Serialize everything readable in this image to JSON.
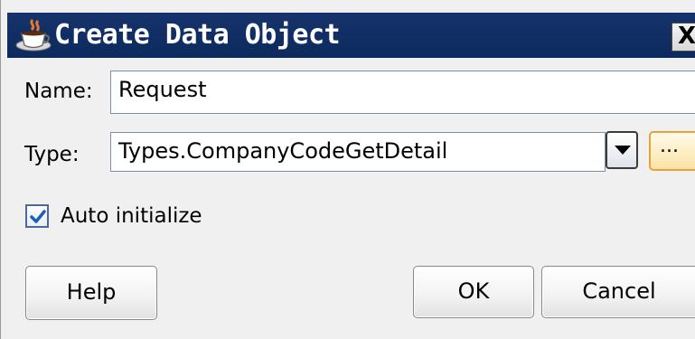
{
  "dialog": {
    "title": "Create Data Object",
    "close_label": "X",
    "title_icon": "coffee-cup-icon"
  },
  "form": {
    "name_label": "Name:",
    "name_value": "Request",
    "type_label": "Type:",
    "type_value": "Types.CompanyCodeGetDetail",
    "browse_label": "...",
    "dropdown_icon": "chevron-down-icon",
    "auto_initialize_label": "Auto initialize",
    "auto_initialize_checked": true
  },
  "buttons": {
    "help": "Help",
    "ok": "OK",
    "cancel": "Cancel"
  }
}
